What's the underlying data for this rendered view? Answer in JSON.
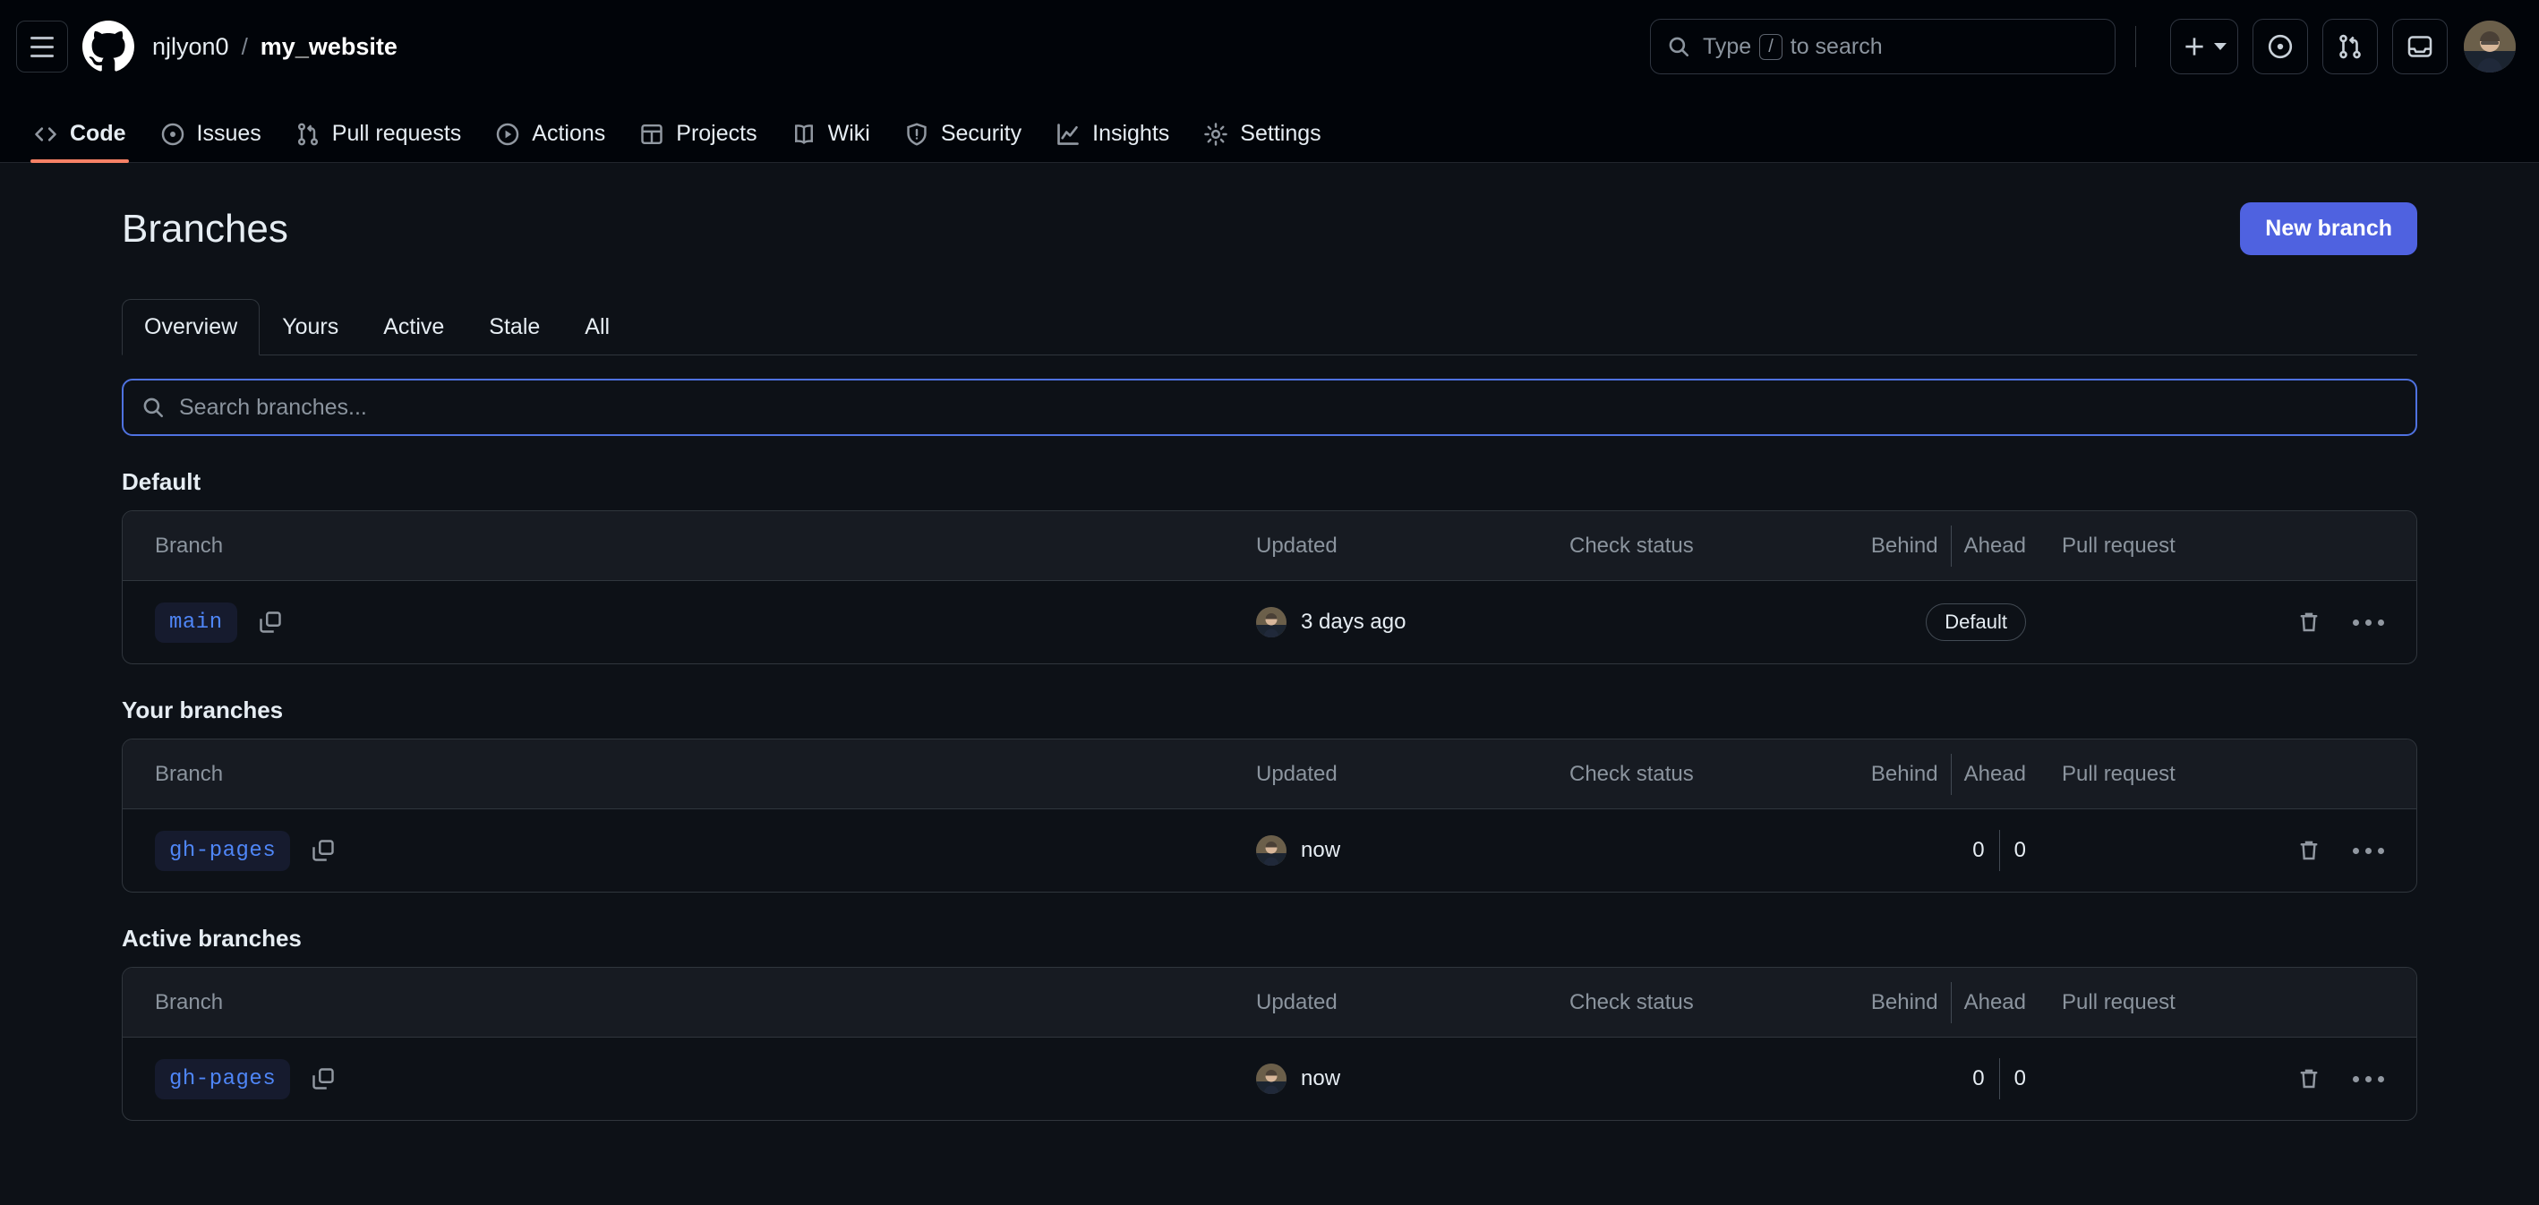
{
  "header": {
    "menu_icon": "hamburger-icon",
    "logo_icon": "github-logo",
    "owner": "njlyon0",
    "separator": "/",
    "repo": "my_website",
    "search": {
      "icon": "search-icon",
      "prefix": "Type",
      "key": "/",
      "suffix": "to search",
      "placeholder": "Type / to search"
    },
    "actions": [
      {
        "name": "create-new-button",
        "icon": "plus-icon",
        "has_caret": true
      },
      {
        "name": "issues-button",
        "icon": "issue-opened-icon",
        "has_caret": false
      },
      {
        "name": "pull-requests-button",
        "icon": "git-pull-request-icon",
        "has_caret": false
      },
      {
        "name": "notifications-button",
        "icon": "inbox-icon",
        "has_caret": false
      }
    ],
    "avatar": "user-avatar"
  },
  "repo_nav": [
    {
      "label": "Code",
      "icon": "code-icon",
      "active": true
    },
    {
      "label": "Issues",
      "icon": "issue-opened-icon",
      "active": false
    },
    {
      "label": "Pull requests",
      "icon": "git-pull-request-icon",
      "active": false
    },
    {
      "label": "Actions",
      "icon": "play-icon",
      "active": false
    },
    {
      "label": "Projects",
      "icon": "table-icon",
      "active": false
    },
    {
      "label": "Wiki",
      "icon": "book-icon",
      "active": false
    },
    {
      "label": "Security",
      "icon": "shield-icon",
      "active": false
    },
    {
      "label": "Insights",
      "icon": "graph-icon",
      "active": false
    },
    {
      "label": "Settings",
      "icon": "gear-icon",
      "active": false
    }
  ],
  "page": {
    "title": "Branches",
    "new_branch_label": "New branch"
  },
  "tabs": [
    {
      "label": "Overview",
      "active": true
    },
    {
      "label": "Yours",
      "active": false
    },
    {
      "label": "Active",
      "active": false
    },
    {
      "label": "Stale",
      "active": false
    },
    {
      "label": "All",
      "active": false
    }
  ],
  "search": {
    "placeholder": "Search branches...",
    "value": "",
    "icon": "search-icon",
    "focused": true
  },
  "columns": {
    "branch": "Branch",
    "updated": "Updated",
    "check_status": "Check status",
    "behind": "Behind",
    "ahead": "Ahead",
    "pull_request": "Pull request"
  },
  "sections": [
    {
      "title": "Default",
      "rows": [
        {
          "branch": "main",
          "updated": "3 days ago",
          "check_status": "",
          "behind": "",
          "ahead": "",
          "badge": "Default",
          "pull_request": "",
          "copy_icon": "copy-icon",
          "delete_icon": "trash-icon",
          "more_icon": "kebab-horizontal-icon"
        }
      ]
    },
    {
      "title": "Your branches",
      "rows": [
        {
          "branch": "gh-pages",
          "updated": "now",
          "check_status": "",
          "behind": "0",
          "ahead": "0",
          "badge": "",
          "pull_request": "",
          "copy_icon": "copy-icon",
          "delete_icon": "trash-icon",
          "more_icon": "kebab-horizontal-icon"
        }
      ]
    },
    {
      "title": "Active branches",
      "rows": [
        {
          "branch": "gh-pages",
          "updated": "now",
          "check_status": "",
          "behind": "0",
          "ahead": "0",
          "badge": "",
          "pull_request": "",
          "copy_icon": "copy-icon",
          "delete_icon": "trash-icon",
          "more_icon": "kebab-horizontal-icon"
        }
      ]
    }
  ],
  "colors": {
    "page_bg": "#0d1117",
    "header_bg": "#010409",
    "border": "#30363d",
    "accent_blue": "#4f62e0",
    "branch_chip_text": "#4f86f7",
    "branch_chip_bg": "#161b2e",
    "active_tab_underline": "#f78166",
    "muted_text": "#8b949e"
  }
}
